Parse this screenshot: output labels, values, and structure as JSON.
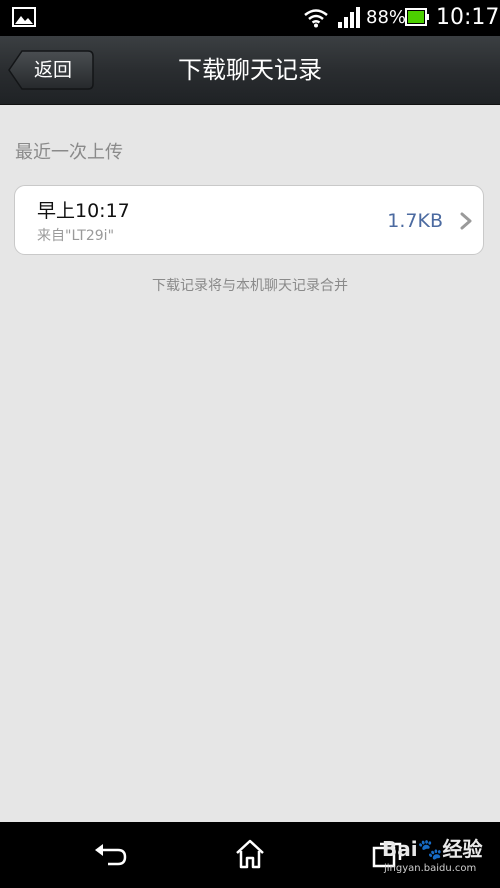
{
  "status_bar": {
    "battery_percent": "88%",
    "time": "10:17",
    "icons": [
      "gallery-icon",
      "wifi-icon",
      "signal-icon",
      "battery-icon"
    ]
  },
  "header": {
    "back_label": "返回",
    "title": "下载聊天记录"
  },
  "main": {
    "section_label": "最近一次上传",
    "record": {
      "time": "早上10:17",
      "source": "来自\"LT29i\"",
      "size": "1.7KB"
    },
    "note": "下载记录将与本机聊天记录合并"
  },
  "nav_bar": {
    "icons": [
      "nav-back-icon",
      "nav-home-icon",
      "nav-recent-icon"
    ]
  },
  "watermark": {
    "text": "Bai🐾经验",
    "subtext": "jingyan.baidu.com"
  },
  "colors": {
    "background": "#e6e6e6",
    "title_bar": "#2a2d30",
    "size_text": "#4b6aa0"
  }
}
